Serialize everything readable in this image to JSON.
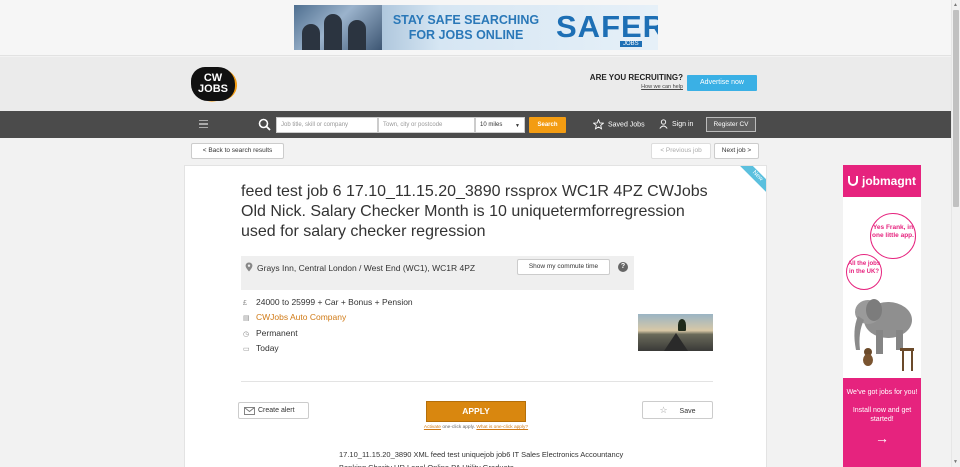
{
  "top_ad": {
    "line1": "STAY SAFE SEARCHING",
    "line2": "FOR JOBS ONLINE",
    "brand": "SAFER",
    "brand_sub": "JOBS"
  },
  "header": {
    "logo_line1": "CW",
    "logo_line2": "JOBS",
    "recruit_question": "ARE YOU RECRUITING?",
    "recruit_link": "How we can help",
    "advertise_label": "Advertise now"
  },
  "nav": {
    "keywords_placeholder": "Job title, skill or company",
    "location_placeholder": "Town, city or postcode",
    "radius_value": "10 miles",
    "search_label": "Search",
    "saved_jobs_label": "Saved Jobs",
    "signin_label": "Sign in",
    "register_label": "Register CV"
  },
  "subnav": {
    "back_label": "< Back to search results",
    "prev_label": "< Previous job",
    "next_label": "Next job >"
  },
  "job": {
    "badge": "New",
    "title": "feed test job 6 17.10_11.15.20_3890 rssprox WC1R 4PZ CWJobs Old Nick. Salary Checker Month is 10 uniquetermforregression used for salary checker regression",
    "location": "Grays Inn, Central London / West End (WC1), WC1R 4PZ",
    "commute_label": "Show my commute time",
    "salary": "24000 to 25999 + Car + Bonus + Pension",
    "company": "CWJobs Auto Company",
    "job_type": "Permanent",
    "posted": "Today",
    "salary_icon": "£",
    "create_alert_label": "Create alert",
    "apply_label": "APPLY",
    "apply_activate": "Activate",
    "apply_middle": " one-click apply. ",
    "apply_what": "What is one-click apply?",
    "save_label": "Save",
    "description": "17.10_11.15.20_3890 XML feed test uniquejob job6 IT Sales Electronics Accountancy Banking Charity HR Legal Online PA Utility Graduate"
  },
  "side_ad": {
    "brand": "jobmagnt",
    "bubble1": "Yes Frank, in one little app.",
    "bubble2": "All the jobs in the UK?",
    "cta1": "We've got jobs for you!",
    "cta2": "Install now and get started!",
    "arrow": "→",
    "accent": "#e6237e"
  },
  "colors": {
    "accent_orange": "#f39c12",
    "nav_bg": "#4b4b4b",
    "advertise_blue": "#3ab0e5",
    "new_ribbon": "#5bc0de"
  }
}
